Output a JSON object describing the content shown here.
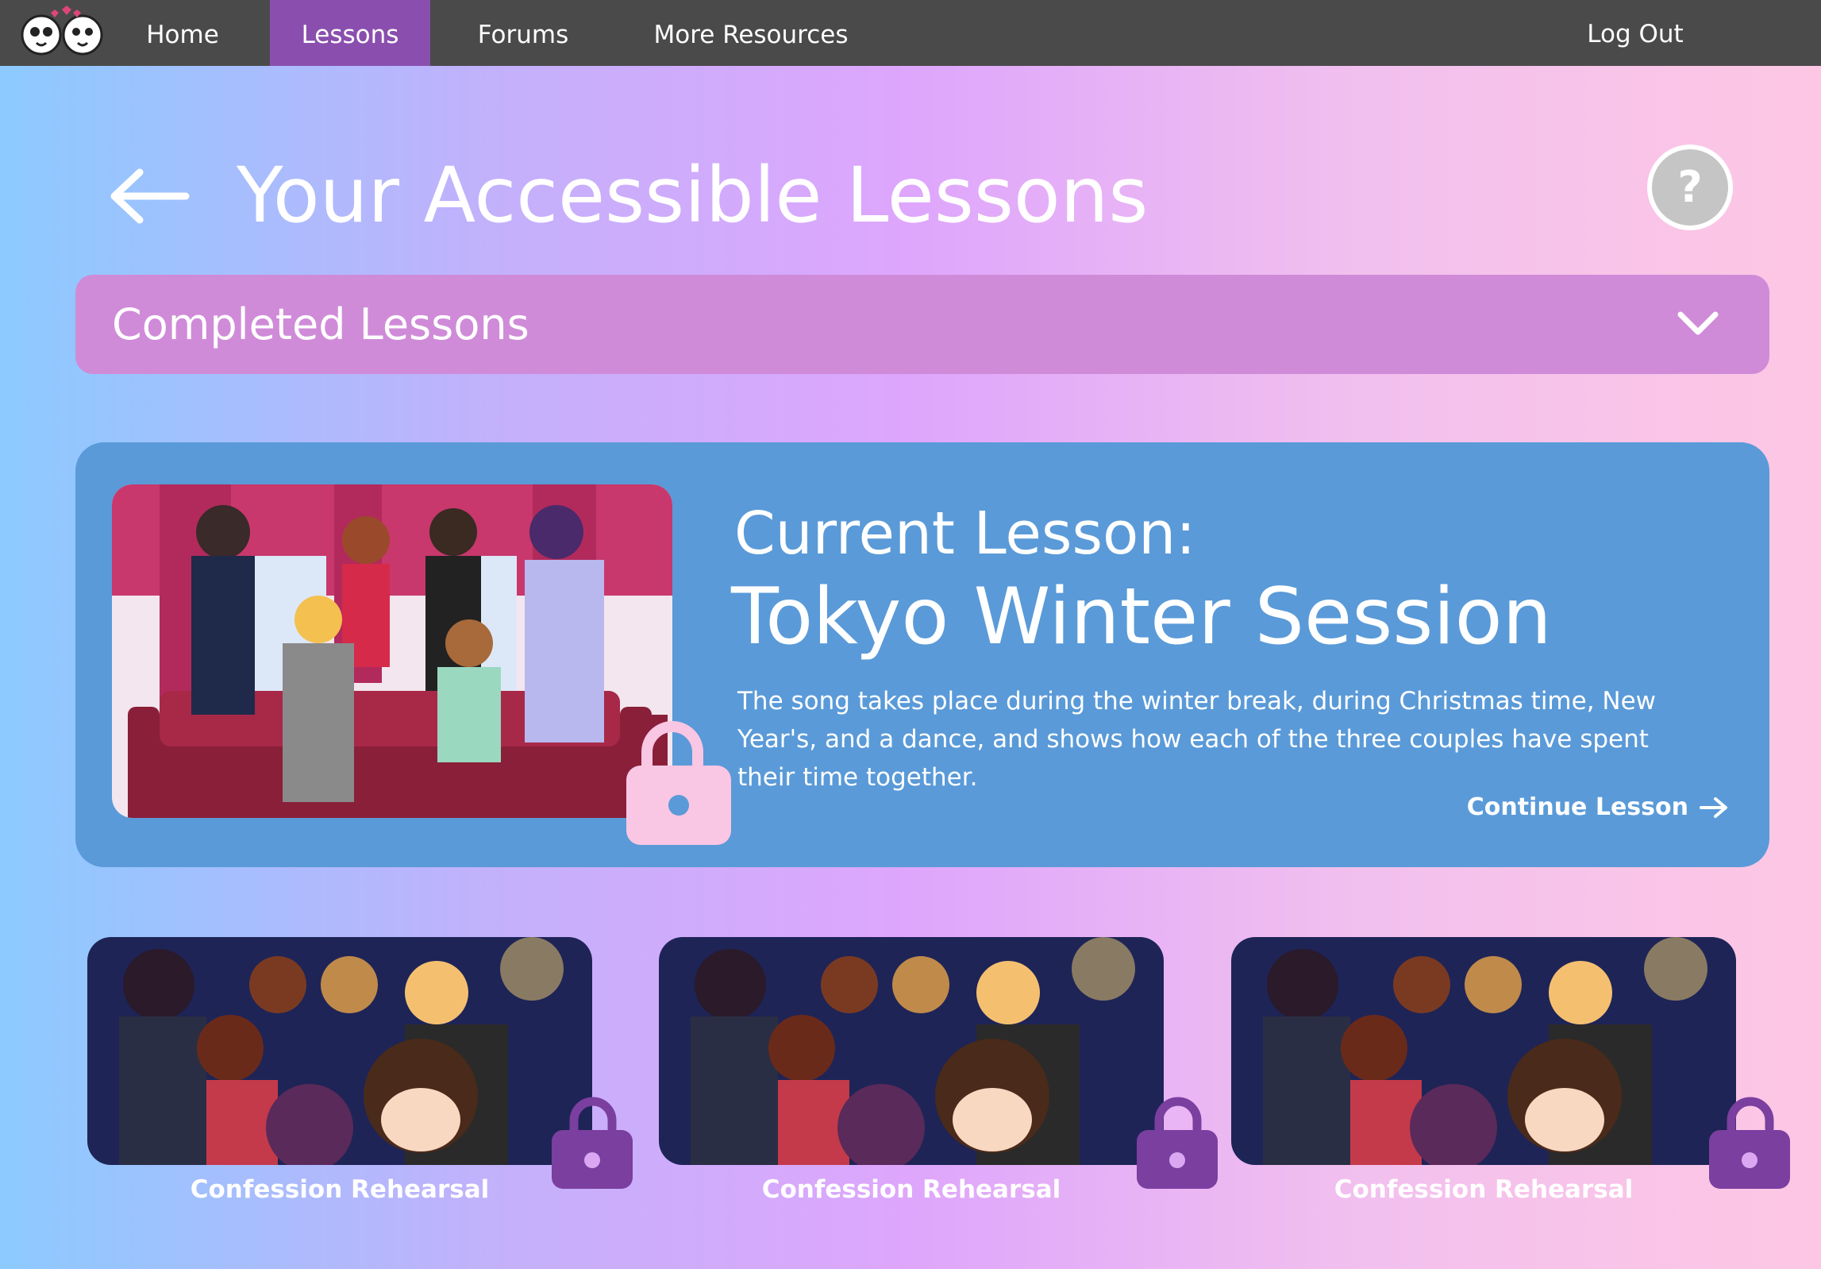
{
  "nav": {
    "items": [
      {
        "label": "Home",
        "active": false
      },
      {
        "label": "Lessons",
        "active": true
      },
      {
        "label": "Forums",
        "active": false
      },
      {
        "label": "More Resources",
        "active": false
      }
    ],
    "logout_label": "Log Out"
  },
  "header": {
    "title": "Your Accessible Lessons",
    "back_icon": "arrow-left-icon",
    "help_icon": "?"
  },
  "accordion": {
    "label": "Completed Lessons",
    "icon": "chevron-down-icon"
  },
  "current_lesson": {
    "eyebrow": "Current Lesson:",
    "title": "Tokyo Winter Session",
    "description": "The song takes place during the winter break, during Christmas time, New Year's, and a dance, and shows how each of the three couples have spent their time together.",
    "continue_label": "Continue Lesson",
    "lock_state": "unlocked"
  },
  "lessons": [
    {
      "title": "Confession Rehearsal",
      "lock_state": "unlocked"
    },
    {
      "title": "Confession Rehearsal",
      "lock_state": "unlocked"
    },
    {
      "title": "Confession Rehearsal",
      "lock_state": "unlocked"
    }
  ],
  "colors": {
    "nav_bg": "#4a4a4a",
    "nav_active": "#8a4fae",
    "accordion": "#cf8bd8",
    "current_card": "#5a9ad8",
    "lock_pink": "#f9c6e3",
    "lock_purple": "#7a3f9f"
  }
}
